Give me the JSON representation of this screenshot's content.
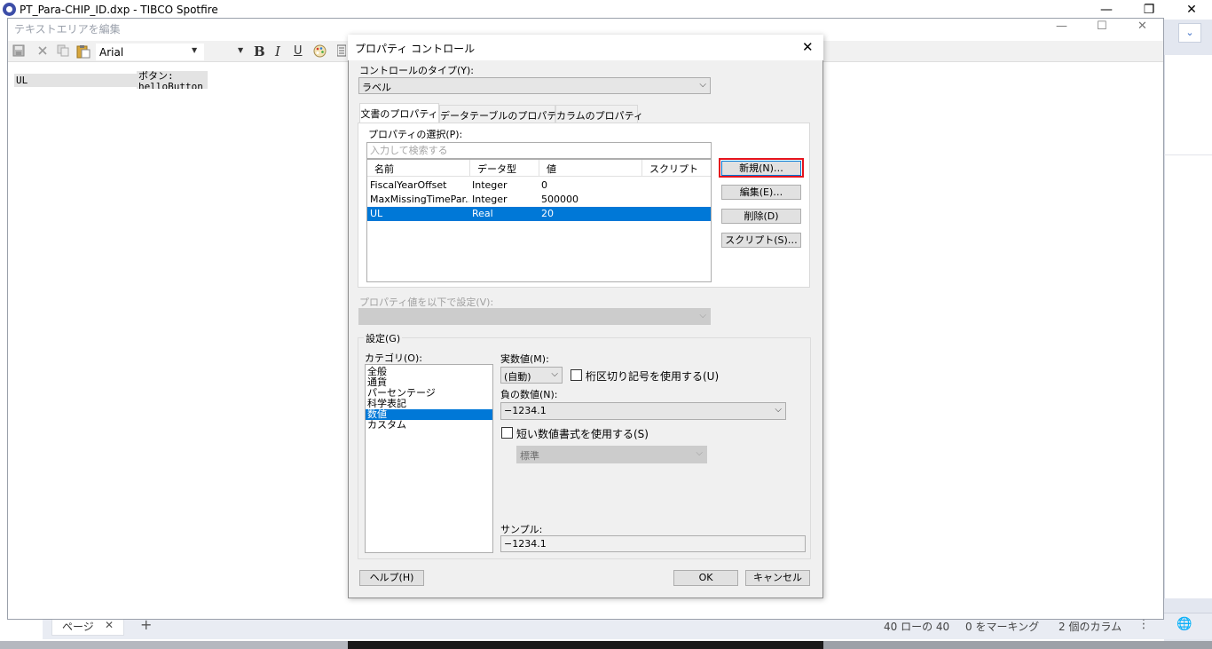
{
  "app": {
    "title": "PT_Para-CHIP_ID.dxp - TIBCO Spotfire",
    "minimize": "—",
    "restore": "❐",
    "close": "✕",
    "expand": "⌄"
  },
  "editor": {
    "title": "テキストエリアを編集",
    "minimize": "—",
    "maximize": "☐",
    "close": "✕",
    "font_name": "Arial",
    "bold": "B",
    "italic": "I",
    "underline": "U",
    "cell_ul": "UL",
    "cell_button": "ボタン: helloButton"
  },
  "dialog": {
    "title": "プロパティ コントロール",
    "close": "✕",
    "control_type_label": "コントロールのタイプ(Y):",
    "control_type_value": "ラベル",
    "tabs": [
      {
        "label": "文書のプロパティ"
      },
      {
        "label": "データテーブルのプロパティ"
      },
      {
        "label": "カラムのプロパティ"
      }
    ],
    "select_property_label": "プロパティの選択(P):",
    "search_placeholder": "入力して検索する",
    "columns": [
      "名前",
      "データ型",
      "値",
      "スクリプト"
    ],
    "rows": [
      {
        "name": "FiscalYearOffset",
        "type": "Integer",
        "value": "0",
        "script": ""
      },
      {
        "name": "MaxMissingTimePar...",
        "type": "Integer",
        "value": "500000",
        "script": ""
      },
      {
        "name": "UL",
        "type": "Real",
        "value": "20",
        "script": ""
      }
    ],
    "buttons": {
      "new": "新規(N)…",
      "edit": "編集(E)…",
      "delete": "削除(D)",
      "script": "スクリプト(S)…"
    },
    "set_value_label": "プロパティ値を以下で設定(V):",
    "settings": {
      "legend": "設定(G)",
      "category_label": "カテゴリ(O):",
      "categories": [
        "全般",
        "通貨",
        "パーセンテージ",
        "科学表記",
        "数値",
        "カスタム"
      ],
      "selected_category": "数値",
      "decimals_label": "実数値(M):",
      "decimals_value": "(自動)",
      "thousands_separator_label": "桁区切り記号を使用する(U)",
      "negative_label": "負の数値(N):",
      "negative_value": "−1234.1",
      "short_format_label": "短い数値書式を使用する(S)",
      "short_format_value": "標準",
      "sample_label": "サンプル:",
      "sample_value": "−1234.1"
    },
    "help_button": "ヘルプ(H)",
    "ok_button": "OK",
    "cancel_button": "キャンセル"
  },
  "statusbar": {
    "page_tab": "ページ",
    "page_tab_close": "✕",
    "add_page": "+",
    "rows": "40 ローの 40",
    "marked": "0 をマーキング",
    "columns": "2 個のカラム",
    "menu": "⋮",
    "globe": "🌐"
  }
}
